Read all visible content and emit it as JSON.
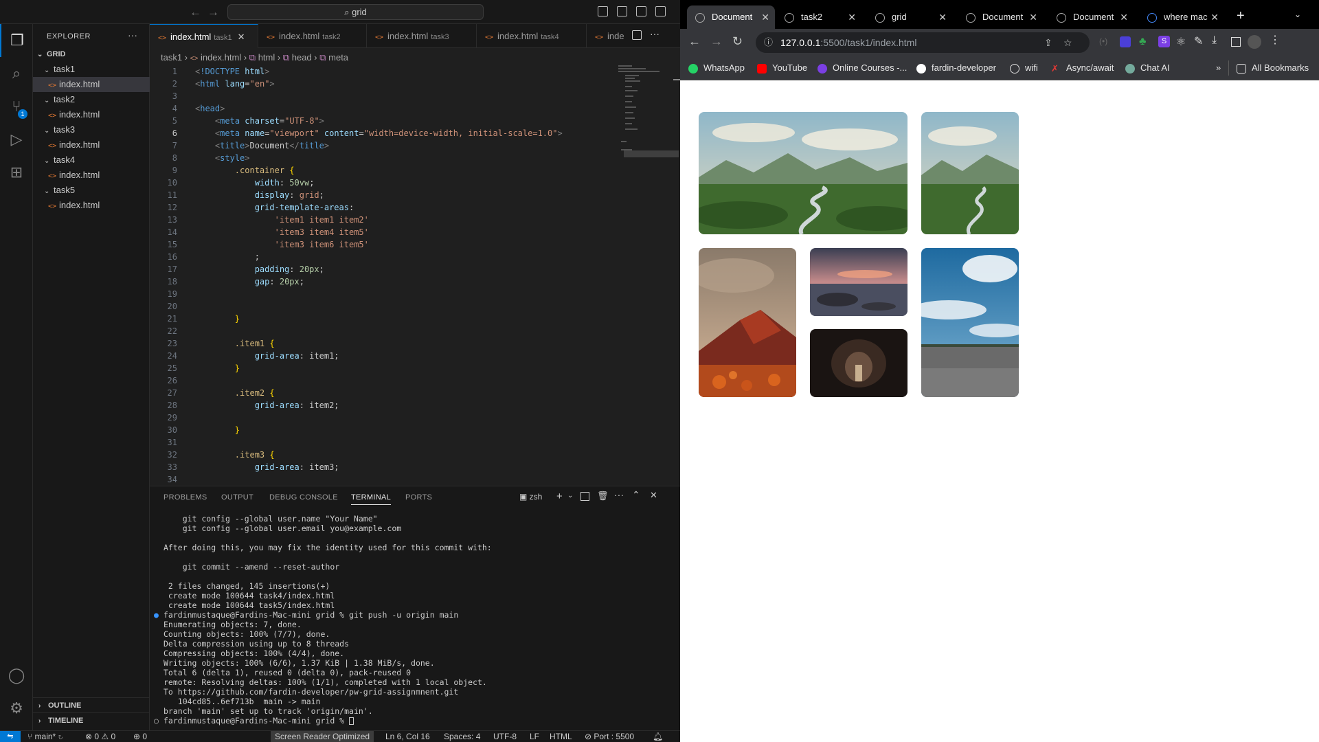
{
  "vscode": {
    "titlebar": {
      "search_text": "⌕ grid"
    },
    "explorer": {
      "title": "EXPLORER",
      "root": "GRID",
      "folders": [
        {
          "name": "task1",
          "file": "index.html"
        },
        {
          "name": "task2",
          "file": "index.html"
        },
        {
          "name": "task3",
          "file": "index.html"
        },
        {
          "name": "task4",
          "file": "index.html"
        },
        {
          "name": "task5",
          "file": "index.html"
        }
      ],
      "outline": "OUTLINE",
      "timeline": "TIMELINE"
    },
    "tabs": [
      {
        "name": "index.html",
        "dir": "task1"
      },
      {
        "name": "index.html",
        "dir": "task2"
      },
      {
        "name": "index.html",
        "dir": "task3"
      },
      {
        "name": "index.html",
        "dir": "task4"
      },
      {
        "name": "inde",
        "dir": ""
      }
    ],
    "breadcrumb": [
      "task1",
      "index.html",
      "html",
      "head",
      "meta"
    ],
    "code_lines": [
      "1",
      "2",
      "3",
      "4",
      "5",
      "6",
      "7",
      "8",
      "9",
      "10",
      "11",
      "12",
      "13",
      "14",
      "15",
      "16",
      "17",
      "18",
      "19",
      "20",
      "21",
      "22",
      "23",
      "24",
      "25",
      "26",
      "27",
      "28",
      "29",
      "30",
      "31",
      "32",
      "33",
      "34"
    ],
    "panel_tabs": [
      "PROBLEMS",
      "OUTPUT",
      "DEBUG CONSOLE",
      "TERMINAL",
      "PORTS"
    ],
    "terminal_shell": "zsh",
    "terminal": [
      "    git config --global user.name \"Your Name\"",
      "    git config --global user.email you@example.com",
      "",
      "After doing this, you may fix the identity used for this commit with:",
      "",
      "    git commit --amend --reset-author",
      "",
      " 2 files changed, 145 insertions(+)",
      " create mode 100644 task4/index.html",
      " create mode 100644 task5/index.html",
      "fardinmustaque@Fardins-Mac-mini grid % git push -u origin main",
      "Enumerating objects: 7, done.",
      "Counting objects: 100% (7/7), done.",
      "Delta compression using up to 8 threads",
      "Compressing objects: 100% (4/4), done.",
      "Writing objects: 100% (6/6), 1.37 KiB | 1.38 MiB/s, done.",
      "Total 6 (delta 1), reused 0 (delta 0), pack-reused 0",
      "remote: Resolving deltas: 100% (1/1), completed with 1 local object.",
      "To https://github.com/fardin-developer/pw-grid-assignmnent.git",
      "   104cd85..6ef713b  main -> main",
      "branch 'main' set up to track 'origin/main'.",
      "fardinmustaque@Fardins-Mac-mini grid % "
    ],
    "status": {
      "branch": "main*",
      "errors": "0",
      "warnings": "0",
      "ports": "0",
      "screen_reader": "Screen Reader Optimized",
      "position": "Ln 6, Col 16",
      "spaces": "Spaces: 4",
      "encoding": "UTF-8",
      "eol": "LF",
      "language": "HTML",
      "port": "Port : 5500"
    }
  },
  "chrome": {
    "tabs": [
      "Document",
      "task2",
      "grid",
      "Document",
      "Document",
      "where mac"
    ],
    "url_host": "127.0.0.1",
    "url_path": ":5500/task1/index.html",
    "bookmarks": [
      "WhatsApp",
      "YouTube",
      "Online Courses -...",
      "fardin-developer",
      "wifi",
      "Async/await",
      "Chat AI"
    ],
    "all_bookmarks": "All Bookmarks",
    "colors": {
      "tab_active": "#35363a",
      "toolbar": "#35363a"
    }
  }
}
